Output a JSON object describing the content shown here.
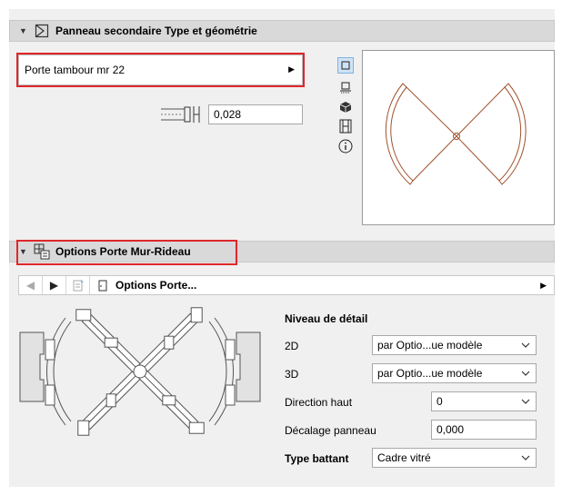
{
  "section1": {
    "title": "Panneau secondaire Type et géométrie",
    "type_button": "Porte tambour mr 22",
    "thickness_value": "0,028"
  },
  "section2": {
    "title": "Options Porte Mur-Rideau",
    "nav_label": "Options Porte...",
    "detail_heading": "Niveau de détail",
    "rows": [
      {
        "label": "2D",
        "value": "par Optio...ue modèle"
      },
      {
        "label": "3D",
        "value": "par Optio...ue modèle"
      },
      {
        "label": "Direction haut",
        "value": "0"
      },
      {
        "label": "Décalage panneau",
        "value": "0,000"
      },
      {
        "label": "Type battant",
        "value": "Cadre vitré"
      }
    ]
  },
  "colors": {
    "highlight": "#e0262a",
    "preview_line": "#a0522d"
  },
  "icons": [
    "collapse-arrow-icon",
    "panel-type-icon",
    "plan-view-icon",
    "elevation-view-icon",
    "3d-view-icon",
    "section-view-icon",
    "info-icon",
    "thickness-icon",
    "cw-door-options-icon",
    "prev-page-icon",
    "next-page-icon",
    "page-list-icon",
    "door-page-icon"
  ]
}
